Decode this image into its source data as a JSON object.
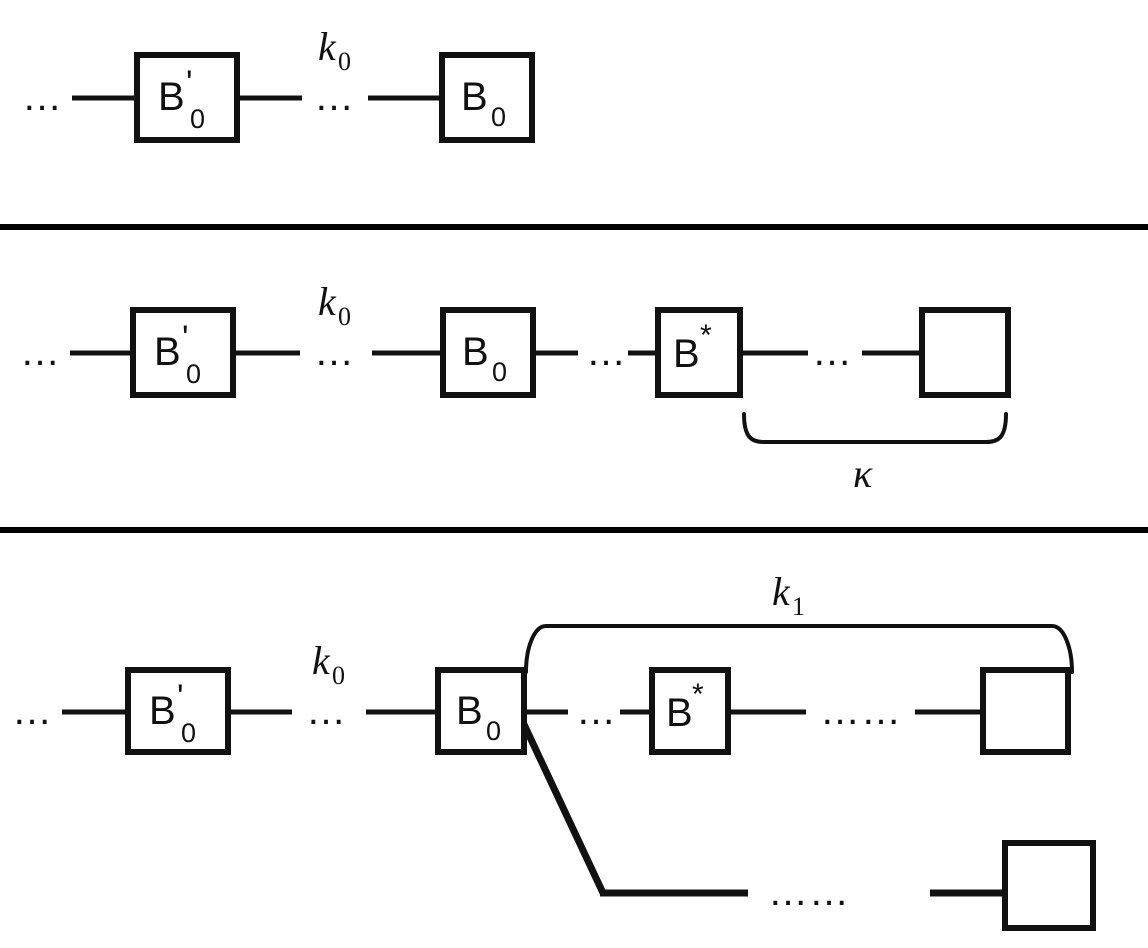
{
  "figure": {
    "background_color": "#ffffff",
    "stroke_color": "#111111",
    "panel_divider_color": "#000000"
  },
  "panels": [
    {
      "id": "panel-1",
      "name": "top-panel",
      "nodes": [
        {
          "id": "p1-ellipsis-left",
          "kind": "ellipsis",
          "text": "…"
        },
        {
          "id": "p1-bprime0",
          "kind": "box",
          "base": "B",
          "prime": "'",
          "subscript": "0",
          "star": ""
        },
        {
          "id": "p1-ellipsis-mid",
          "kind": "ellipsis",
          "text": "…"
        },
        {
          "id": "p1-b0",
          "kind": "box",
          "base": "B",
          "prime": "",
          "subscript": "0",
          "star": ""
        }
      ],
      "labels": [
        {
          "id": "p1-k0",
          "kind": "gap-label",
          "base": "k",
          "subscript": "0"
        }
      ]
    },
    {
      "id": "panel-2",
      "name": "middle-panel",
      "nodes": [
        {
          "id": "p2-ellipsis-left",
          "kind": "ellipsis",
          "text": "…"
        },
        {
          "id": "p2-bprime0",
          "kind": "box",
          "base": "B",
          "prime": "'",
          "subscript": "0",
          "star": ""
        },
        {
          "id": "p2-ellipsis-mid",
          "kind": "ellipsis",
          "text": "…"
        },
        {
          "id": "p2-b0",
          "kind": "box",
          "base": "B",
          "prime": "",
          "subscript": "0",
          "star": ""
        },
        {
          "id": "p2-ellipsis-2",
          "kind": "ellipsis",
          "text": "…"
        },
        {
          "id": "p2-bstar",
          "kind": "box",
          "base": "B",
          "prime": "",
          "subscript": "",
          "star": "*"
        },
        {
          "id": "p2-ellipsis-3",
          "kind": "ellipsis",
          "text": "…"
        },
        {
          "id": "p2-empty",
          "kind": "box",
          "base": "",
          "prime": "",
          "subscript": "",
          "star": ""
        }
      ],
      "labels": [
        {
          "id": "p2-k0",
          "kind": "gap-label",
          "base": "k",
          "subscript": "0"
        },
        {
          "id": "p2-kappa",
          "kind": "brace-label",
          "base": "κ",
          "subscript": ""
        }
      ],
      "brace": {
        "id": "p2-brace-kappa",
        "orientation": "under",
        "label_id": "p2-kappa"
      }
    },
    {
      "id": "panel-3",
      "name": "bottom-panel",
      "nodes": [
        {
          "id": "p3-ellipsis-left",
          "kind": "ellipsis",
          "text": "…"
        },
        {
          "id": "p3-bprime0",
          "kind": "box",
          "base": "B",
          "prime": "'",
          "subscript": "0",
          "star": ""
        },
        {
          "id": "p3-ellipsis-mid",
          "kind": "ellipsis",
          "text": "…"
        },
        {
          "id": "p3-b0",
          "kind": "box",
          "base": "B",
          "prime": "",
          "subscript": "0",
          "star": ""
        },
        {
          "id": "p3-ellipsis-2",
          "kind": "ellipsis",
          "text": "…"
        },
        {
          "id": "p3-bstar",
          "kind": "box",
          "base": "B",
          "prime": "",
          "subscript": "",
          "star": "*"
        },
        {
          "id": "p3-ellipsis-3",
          "kind": "ellipsis-long",
          "text": "……"
        },
        {
          "id": "p3-empty-top",
          "kind": "box",
          "base": "",
          "prime": "",
          "subscript": "",
          "star": ""
        },
        {
          "id": "p3-ellipsis-branch",
          "kind": "ellipsis-long",
          "text": "……"
        },
        {
          "id": "p3-empty-branch",
          "kind": "box",
          "base": "",
          "prime": "",
          "subscript": "",
          "star": ""
        }
      ],
      "labels": [
        {
          "id": "p3-k0",
          "kind": "gap-label",
          "base": "k",
          "subscript": "0"
        },
        {
          "id": "p3-k1",
          "kind": "brace-label",
          "base": "k",
          "subscript": "1"
        }
      ],
      "brace": {
        "id": "p3-brace-k1",
        "orientation": "over",
        "label_id": "p3-k1"
      }
    }
  ],
  "text": {
    "B": "B",
    "prime": "'",
    "star": "*",
    "zero": "0",
    "one": "1",
    "k": "k",
    "kappa": "κ",
    "ellipsis": "…",
    "ellipsis_long": "……"
  }
}
